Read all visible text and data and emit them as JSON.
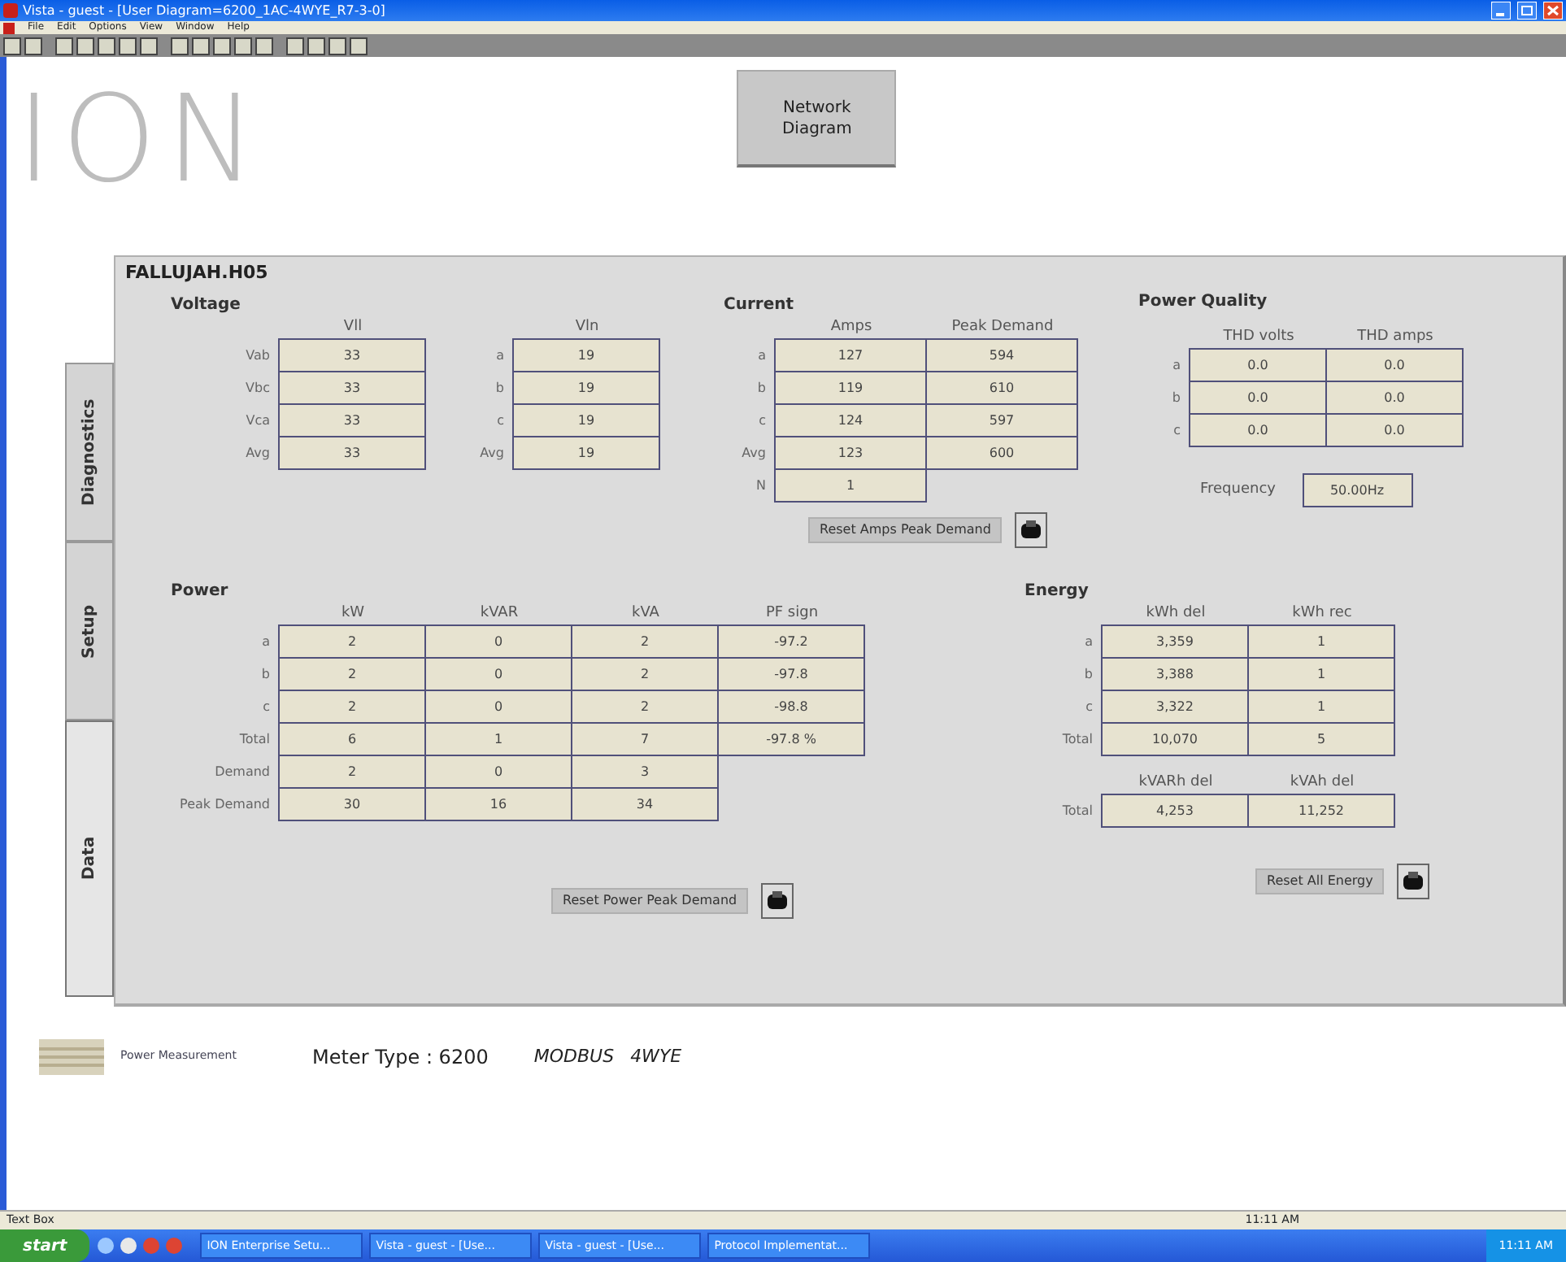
{
  "window": {
    "title": "Vista - guest - [User Diagram=6200_1AC-4WYE_R7-3-0]"
  },
  "menu": [
    "File",
    "Edit",
    "Options",
    "View",
    "Window",
    "Help"
  ],
  "logo": "ION",
  "network_button": "Network Diagram",
  "meter_name": "FALLUJAH.H05",
  "side_tabs": [
    {
      "label": "Diagnostics",
      "selected": false
    },
    {
      "label": "Setup",
      "selected": false
    },
    {
      "label": "Data",
      "selected": true
    }
  ],
  "voltage": {
    "title": "Voltage",
    "tables": [
      {
        "columns": [
          "Vll"
        ],
        "rows": [
          {
            "label": "Vab",
            "cells": [
              "33"
            ]
          },
          {
            "label": "Vbc",
            "cells": [
              "33"
            ]
          },
          {
            "label": "Vca",
            "cells": [
              "33"
            ]
          },
          {
            "label": "Avg",
            "cells": [
              "33"
            ]
          }
        ]
      },
      {
        "columns": [
          "Vln"
        ],
        "rows": [
          {
            "label": "a",
            "cells": [
              "19"
            ]
          },
          {
            "label": "b",
            "cells": [
              "19"
            ]
          },
          {
            "label": "c",
            "cells": [
              "19"
            ]
          },
          {
            "label": "Avg",
            "cells": [
              "19"
            ]
          }
        ]
      }
    ]
  },
  "current": {
    "title": "Current",
    "tables": [
      {
        "columns": [
          "Amps",
          "Peak Demand"
        ],
        "rows": [
          {
            "label": "a",
            "cells": [
              "127",
              "594"
            ]
          },
          {
            "label": "b",
            "cells": [
              "119",
              "610"
            ]
          },
          {
            "label": "c",
            "cells": [
              "124",
              "597"
            ]
          },
          {
            "label": "Avg",
            "cells": [
              "123",
              "600"
            ]
          },
          {
            "label": "N",
            "cells": [
              "1"
            ]
          }
        ]
      }
    ],
    "button": "Reset Amps Peak Demand"
  },
  "power_quality": {
    "title": "Power Quality",
    "tables": [
      {
        "columns": [
          "THD volts",
          "THD amps"
        ],
        "rows": [
          {
            "label": "a",
            "cells": [
              "0.0",
              "0.0"
            ]
          },
          {
            "label": "b",
            "cells": [
              "0.0",
              "0.0"
            ]
          },
          {
            "label": "c",
            "cells": [
              "0.0",
              "0.0"
            ]
          }
        ]
      }
    ],
    "frequency": {
      "label": "Frequency",
      "value": "50.00Hz"
    }
  },
  "power": {
    "title": "Power",
    "tables": [
      {
        "columns": [
          "kW",
          "kVAR",
          "kVA",
          "PF sign"
        ],
        "rows": [
          {
            "label": "a",
            "cells": [
              "2",
              "0",
              "2",
              "-97.2"
            ]
          },
          {
            "label": "b",
            "cells": [
              "2",
              "0",
              "2",
              "-97.8"
            ]
          },
          {
            "label": "c",
            "cells": [
              "2",
              "0",
              "2",
              "-98.8"
            ]
          },
          {
            "label": "Total",
            "cells": [
              "6",
              "1",
              "7",
              "-97.8 %"
            ]
          },
          {
            "label": "Demand",
            "cells": [
              "2",
              "0",
              "3"
            ]
          },
          {
            "label": "Peak Demand",
            "cells": [
              "30",
              "16",
              "34"
            ]
          }
        ]
      }
    ],
    "button": "Reset Power Peak Demand"
  },
  "energy": {
    "title": "Energy",
    "tables": [
      {
        "columns": [
          "kWh del",
          "kWh rec"
        ],
        "rows": [
          {
            "label": "a",
            "cells": [
              "3,359",
              "1"
            ]
          },
          {
            "label": "b",
            "cells": [
              "3,388",
              "1"
            ]
          },
          {
            "label": "c",
            "cells": [
              "3,322",
              "1"
            ]
          },
          {
            "label": "Total",
            "cells": [
              "10,070",
              "5"
            ]
          }
        ]
      },
      {
        "columns": [
          "kVARh del",
          "kVAh del"
        ],
        "rows": [
          {
            "label": "Total",
            "cells": [
              "4,253",
              "11,252"
            ]
          }
        ]
      }
    ],
    "button": "Reset All Energy"
  },
  "footer": {
    "company": "Power Measurement",
    "meter_type": "Meter Type : 6200",
    "protocol": "MODBUS",
    "wiring": "4WYE"
  },
  "status_bar": {
    "text": "Text Box",
    "time": "11:11 AM"
  },
  "taskbar": {
    "start": "start",
    "tasks": [
      "ION Enterprise Setu...",
      "Vista - guest - [Use...",
      "Vista - guest - [Use...",
      "Protocol Implementat..."
    ],
    "clock": "11:11 AM"
  }
}
